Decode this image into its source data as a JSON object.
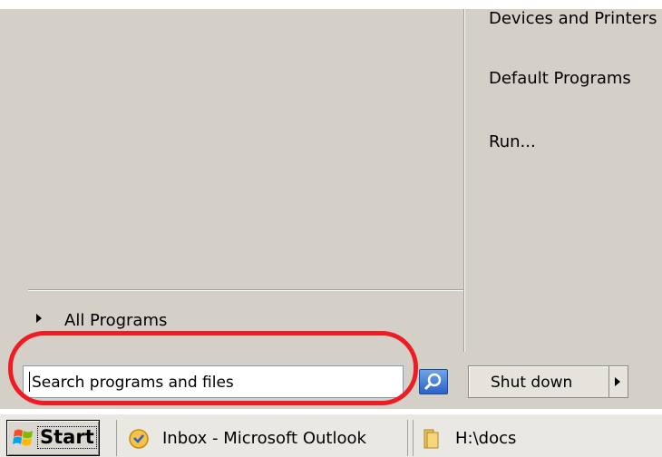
{
  "start_menu": {
    "right_items": [
      "Devices and Printers",
      "Default Programs",
      "Run..."
    ],
    "all_programs_label": "All Programs",
    "search": {
      "placeholder": "Search programs and files"
    },
    "shutdown_label": "Shut down"
  },
  "annotation": {
    "color": "#ee1c24",
    "shape": "ellipse around search box"
  },
  "taskbar": {
    "start_label": "Start",
    "tasks": [
      {
        "label": "Inbox - Microsoft Outlook",
        "icon": "outlook-icon"
      },
      {
        "label": "H:\\docs",
        "icon": "folder-icon"
      }
    ]
  }
}
